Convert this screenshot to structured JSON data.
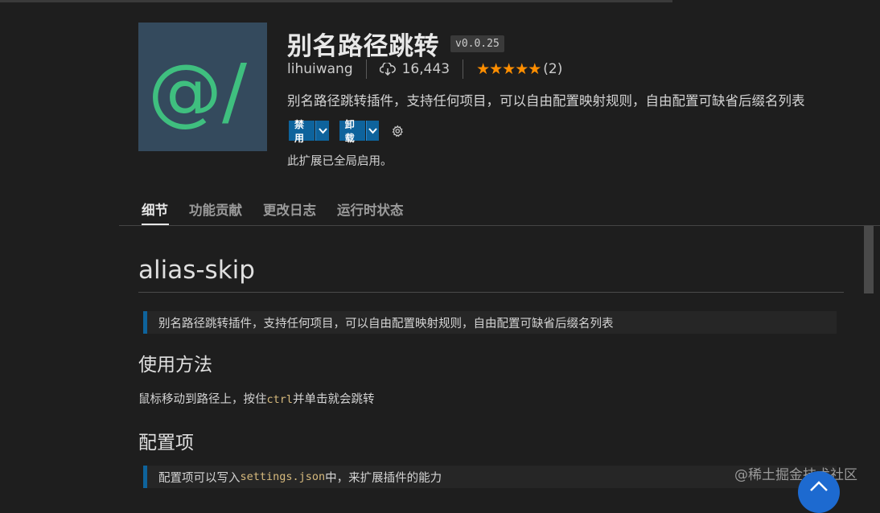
{
  "extension": {
    "icon_text": "@/",
    "title": "别名路径跳转",
    "version": "v0.0.25",
    "publisher": "lihuiwang",
    "installs": "16,443",
    "stars": "★★★★★",
    "rating_count": "(2)",
    "description": "别名路径跳转插件，支持任何项目，可以自由配置映射规则，自由配置可缺省后缀名列表",
    "disable_label": "禁用",
    "uninstall_label": "卸载",
    "enabled_note": "此扩展已全局启用。"
  },
  "tabs": [
    {
      "label": "细节",
      "active": true
    },
    {
      "label": "功能贡献",
      "active": false
    },
    {
      "label": "更改日志",
      "active": false
    },
    {
      "label": "运行时状态",
      "active": false
    }
  ],
  "readme": {
    "h1": "alias-skip",
    "quote1": "别名路径跳转插件，支持任何项目，可以自由配置映射规则，自由配置可缺省后缀名列表",
    "h2_usage": "使用方法",
    "usage_before": "鼠标移动到路径上，按住",
    "usage_code": "ctrl",
    "usage_after": "并单击就会跳转",
    "h2_config": "配置项",
    "config_before": "配置项可以写入",
    "config_code": "settings.json",
    "config_after": "中，来扩展插件的能力"
  },
  "watermark": "@稀土掘金技术社区",
  "colors": {
    "accent": "#0e639c",
    "star": "#ff8e00",
    "icon_bg": "#344a5d",
    "icon_fg": "#3fbf7f",
    "scroll_top": "#1d6ad0"
  }
}
